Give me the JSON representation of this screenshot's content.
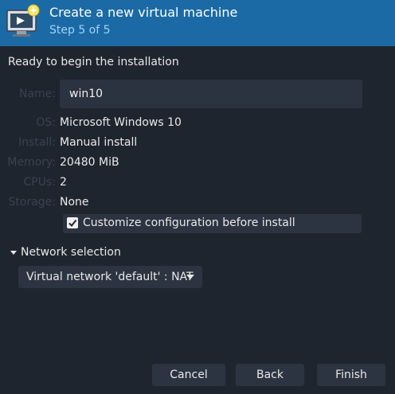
{
  "header": {
    "title": "Create a new virtual machine",
    "subtitle": "Step 5 of 5"
  },
  "section_title": "Ready to begin the installation",
  "fields": {
    "name_label": "Name:",
    "name_value": "win10",
    "os_label": "OS:",
    "os_value": "Microsoft Windows 10",
    "install_label": "Install:",
    "install_value": "Manual install",
    "memory_label": "Memory:",
    "memory_value": "20480 MiB",
    "cpus_label": "CPUs:",
    "cpus_value": "2",
    "storage_label": "Storage:",
    "storage_value": "None"
  },
  "customize": {
    "label": "Customize configuration before install",
    "checked": true
  },
  "network": {
    "expander_label": "Network selection",
    "selected": "Virtual network 'default' : NAT"
  },
  "buttons": {
    "cancel": "Cancel",
    "back": "Back",
    "finish": "Finish"
  },
  "colors": {
    "header_bg": "#1b6aa6",
    "window_bg": "#1f252f",
    "subtitle": "#9fd3f7"
  }
}
